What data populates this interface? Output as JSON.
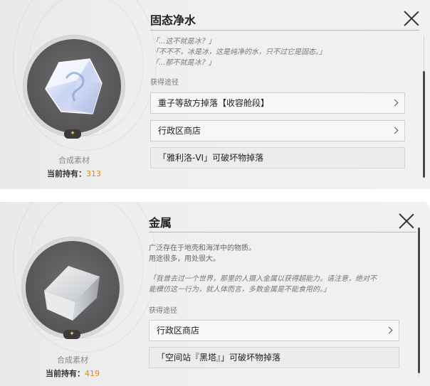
{
  "panels": [
    {
      "title": "固态净水",
      "item_icon": "ice-cube-icon",
      "badge": "✦",
      "category": "合成素材",
      "holding_label": "当前持有：",
      "holding_count": "313",
      "quotes": [
        "「...这不就是冰？」",
        "「不不不，冰是冰，这是纯净的水，只不过它是固态。」",
        "「...那不就是冰？」"
      ],
      "source_heading": "获得途径",
      "sources": [
        {
          "label": "重子等敌方掉落【收容舱段】",
          "link": true
        },
        {
          "label": "行政区商店",
          "link": true
        },
        {
          "label": "「雅利洛-VI」可破坏物掉落",
          "link": false
        }
      ]
    },
    {
      "title": "金属",
      "item_icon": "metal-cube-icon",
      "badge": "✦",
      "category": "合成素材",
      "holding_label": "当前持有：",
      "holding_count": "419",
      "cut_text": "",
      "desc": [
        "广泛存在于地壳和海洋中的物质。",
        "用途很多，用处很大。"
      ],
      "quote": [
        "「我曾去过一个世界，那里的人摄入金属以获得超能力。请注意，绝对不",
        "能模仿这一行为，就人体而言，多数金属是不能食用的。」"
      ],
      "source_heading": "获得途径",
      "sources": [
        {
          "label": "行政区商店",
          "link": true
        },
        {
          "label": "「空间站『黑塔』」可破坏物掉落",
          "link": false
        }
      ]
    }
  ],
  "colors": {
    "accent": "#d98a1a",
    "disc": "#5a585b"
  }
}
